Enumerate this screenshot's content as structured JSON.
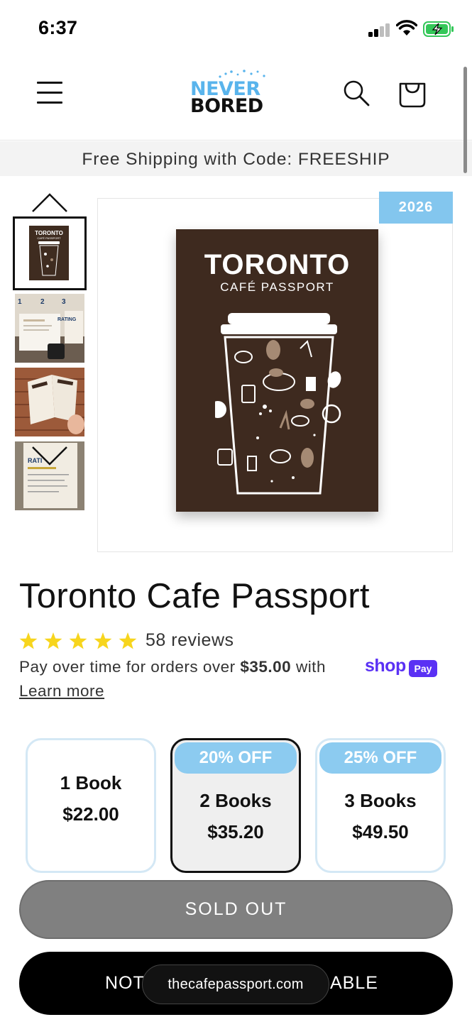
{
  "status_bar": {
    "time": "6:37"
  },
  "header": {
    "logo_top": "NEVER",
    "logo_bottom": "BORED"
  },
  "promo": {
    "text": "Free Shipping with Code: FREESHIP"
  },
  "gallery": {
    "year_badge": "2026",
    "book_title": "TORONTO",
    "book_subtitle": "CAFÉ PASSPORT",
    "thumb_title": "TORONTO",
    "thumb_subtitle": "CAFÉ PASSPORT",
    "thumbnails": [
      "cover",
      "rating-steps",
      "book-open-hand",
      "rating-page"
    ]
  },
  "product": {
    "title": "Toronto Cafe Passport",
    "rating": 5,
    "reviews": "58 reviews",
    "installments_prefix": "Pay over time for orders over ",
    "installments_amount": "$35.00",
    "installments_suffix": " with",
    "shop_label": "shop",
    "pay_label": "Pay",
    "learn_more": "Learn more"
  },
  "bundles": [
    {
      "badge": "",
      "qty": "1 Book",
      "price": "$22.00",
      "selected": false
    },
    {
      "badge": "20% OFF",
      "qty": "2 Books",
      "price": "$35.20",
      "selected": true
    },
    {
      "badge": "25% OFF",
      "qty": "3 Books",
      "price": "$49.50",
      "selected": false
    }
  ],
  "actions": {
    "sold_out": "SOLD OUT",
    "notify_left": "NOT",
    "notify_right": "ABLE"
  },
  "browser": {
    "url": "thecafepassport.com"
  },
  "colors": {
    "accent_blue": "#8ccbf0",
    "shop_pay": "#5a31f4",
    "star": "#f7d51d",
    "book_brown": "#3e2a1f"
  }
}
